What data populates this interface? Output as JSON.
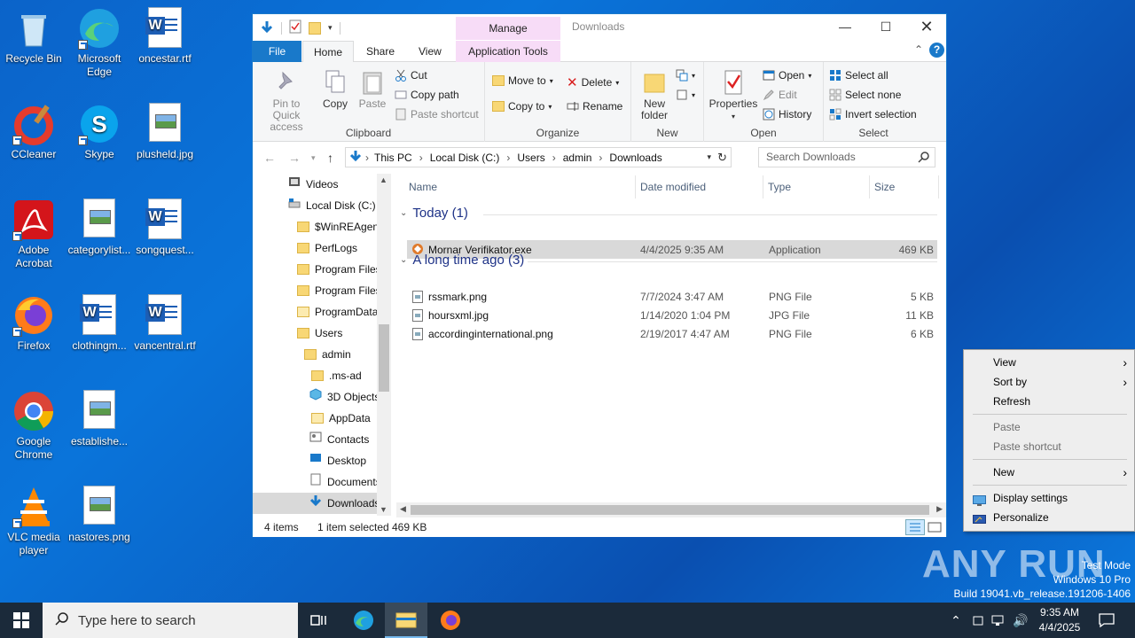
{
  "desktop": {
    "icons": [
      {
        "label": "Recycle Bin"
      },
      {
        "label": "Microsoft Edge"
      },
      {
        "label": "oncestar.rtf"
      },
      {
        "label": "CCleaner"
      },
      {
        "label": "Skype"
      },
      {
        "label": "plusheld.jpg"
      },
      {
        "label": "Adobe Acrobat"
      },
      {
        "label": "categorylist..."
      },
      {
        "label": "songquest..."
      },
      {
        "label": "Firefox"
      },
      {
        "label": "clothingm..."
      },
      {
        "label": "vancentral.rtf"
      },
      {
        "label": "Google Chrome"
      },
      {
        "label": "establishe..."
      },
      {
        "label": "VLC media player"
      },
      {
        "label": "nastores.png"
      }
    ]
  },
  "explorer": {
    "title": "Downloads",
    "manage_label": "Manage",
    "tabs": {
      "file": "File",
      "home": "Home",
      "share": "Share",
      "view": "View",
      "app_tools": "Application Tools"
    },
    "ribbon": {
      "clipboard": {
        "label": "Clipboard",
        "pin": "Pin to Quick access",
        "copy": "Copy",
        "paste": "Paste",
        "cut": "Cut",
        "copy_path": "Copy path",
        "paste_shortcut": "Paste shortcut"
      },
      "organize": {
        "label": "Organize",
        "move_to": "Move to",
        "copy_to": "Copy to",
        "delete": "Delete",
        "rename": "Rename"
      },
      "new": {
        "label": "New",
        "new_folder": "New folder"
      },
      "open": {
        "label": "Open",
        "properties": "Properties",
        "open": "Open",
        "edit": "Edit",
        "history": "History"
      },
      "select": {
        "label": "Select",
        "select_all": "Select all",
        "select_none": "Select none",
        "invert": "Invert selection"
      }
    },
    "address": {
      "crumbs": [
        "This PC",
        "Local Disk (C:)",
        "Users",
        "admin",
        "Downloads"
      ],
      "search_placeholder": "Search Downloads"
    },
    "nav_items": [
      "Videos",
      "Local Disk (C:)",
      "$WinREAgent",
      "PerfLogs",
      "Program Files",
      "Program Files",
      "ProgramData",
      "Users",
      "admin",
      ".ms-ad",
      "3D Objects",
      "AppData",
      "Contacts",
      "Desktop",
      "Documents",
      "Downloads"
    ],
    "columns": {
      "name": "Name",
      "date": "Date modified",
      "type": "Type",
      "size": "Size"
    },
    "groups": [
      {
        "title": "Today (1)",
        "files": [
          {
            "name": "Mornar Verifikator.exe",
            "date": "4/4/2025 9:35 AM",
            "type": "Application",
            "size": "469 KB"
          }
        ]
      },
      {
        "title": "A long time ago (3)",
        "files": [
          {
            "name": "rssmark.png",
            "date": "7/7/2024 3:47 AM",
            "type": "PNG File",
            "size": "5 KB"
          },
          {
            "name": "hoursxml.jpg",
            "date": "1/14/2020 1:04 PM",
            "type": "JPG File",
            "size": "11 KB"
          },
          {
            "name": "accordinginternational.png",
            "date": "2/19/2017 4:47 AM",
            "type": "PNG File",
            "size": "6 KB"
          }
        ]
      }
    ],
    "status": {
      "count": "4 items",
      "selected": "1 item selected",
      "size": "469 KB"
    }
  },
  "context_menu": {
    "view": "View",
    "sort_by": "Sort by",
    "refresh": "Refresh",
    "paste": "Paste",
    "paste_shortcut": "Paste shortcut",
    "new": "New",
    "display_settings": "Display settings",
    "personalize": "Personalize"
  },
  "watermark": {
    "line1": "Test Mode",
    "line2": "Windows 10 Pro",
    "line3": "Build 19041.vb_release.191206-1406",
    "brand": "ANY RUN"
  },
  "taskbar": {
    "search_placeholder": "Type here to search",
    "time": "9:35 AM",
    "date": "4/4/2025"
  },
  "colors": {
    "accent": "#1979ca",
    "manage_tab": "#f7dcf7",
    "selection": "#d9d9d9",
    "taskbar": "#1b2a3a"
  }
}
